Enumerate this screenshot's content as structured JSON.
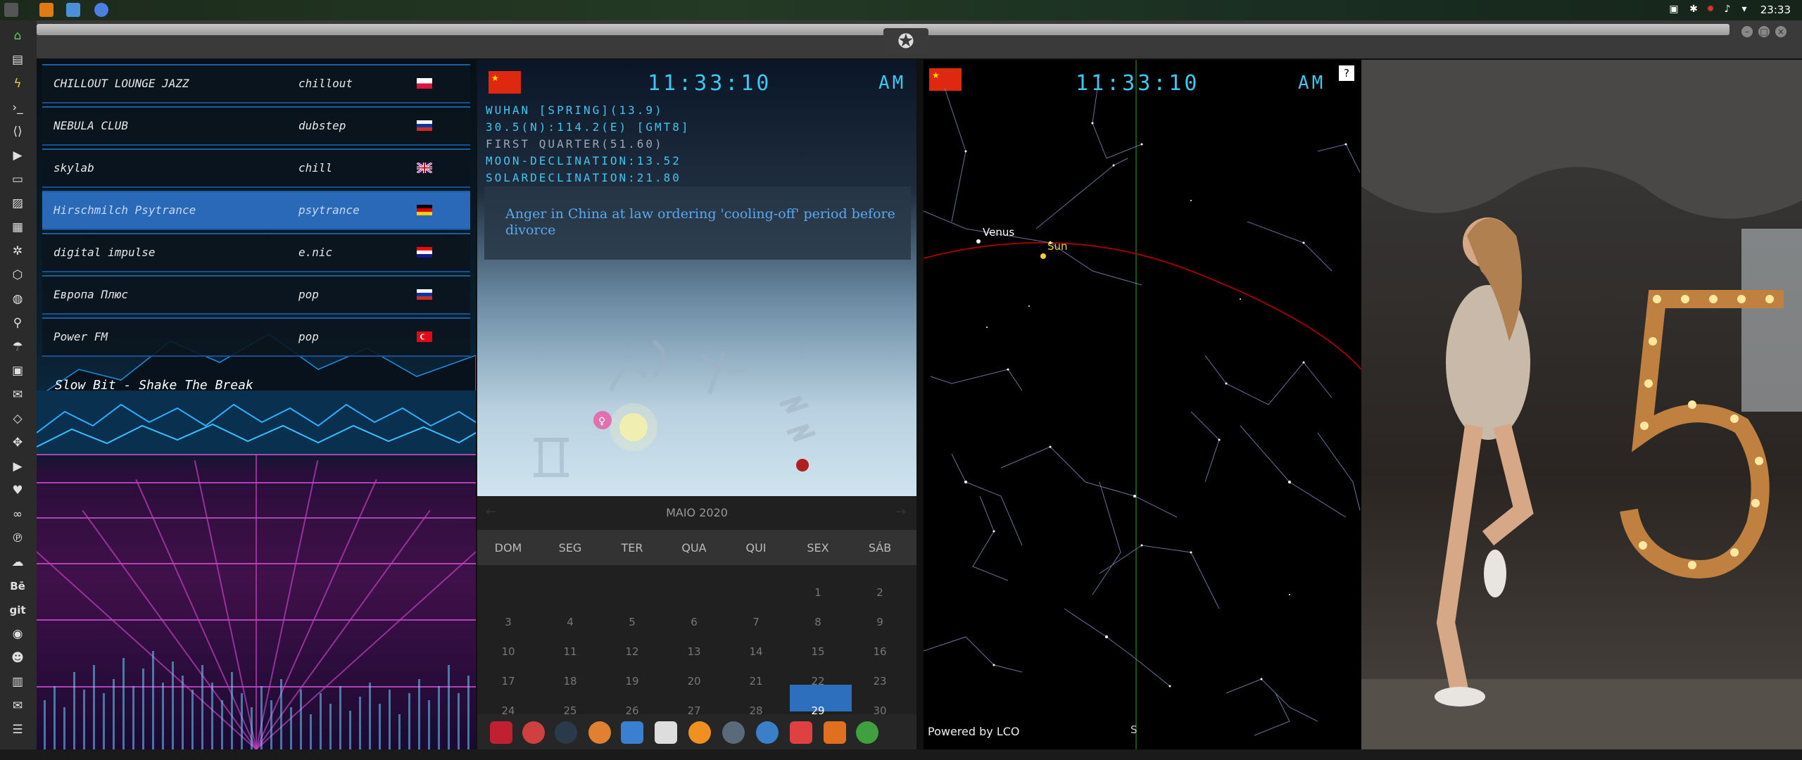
{
  "system": {
    "clock": "23:33",
    "tray_icons": [
      "photo-icon",
      "bluetooth-icon",
      "gear-red-icon",
      "volume-icon",
      "wifi-icon"
    ]
  },
  "radio": {
    "stations": [
      {
        "name": "CHILLOUT LOUNGE JAZZ",
        "genre": "chillout",
        "flag": "poland"
      },
      {
        "name": "NEBULA CLUB",
        "genre": "dubstep",
        "flag": "russia"
      },
      {
        "name": "skylab",
        "genre": "chill",
        "flag": "uk"
      },
      {
        "name": "Hirschmilch Psytrance",
        "genre": "psytrance",
        "flag": "germany"
      },
      {
        "name": "digital impulse",
        "genre": "e.nic",
        "flag": "croatia"
      },
      {
        "name": "Европа Плюс",
        "genre": "pop",
        "flag": "russia"
      },
      {
        "name": "Power FM",
        "genre": "pop",
        "flag": "turkey"
      }
    ],
    "now_playing": "Slow Bit - Shake The Break"
  },
  "clock_panel": {
    "time": "11:33:10",
    "ampm": "AM",
    "lines": [
      "WUHAN [SPRING](13.9)",
      "30.5(N):114.2(E) [GMT8]",
      "FIRST QUARTER(51.60)",
      "MOON-DECLINATION:13.52",
      "SOLARDECLINATION:21.80"
    ],
    "news": "Anger in China at law ordering 'cooling-off' period before divorce"
  },
  "calendar": {
    "month": "MAIO 2020",
    "days": [
      "DOM",
      "SEG",
      "TER",
      "QUA",
      "QUI",
      "SEX",
      "SÁB"
    ],
    "weeks": [
      [
        "",
        "",
        "",
        "",
        "",
        "1",
        "2"
      ],
      [
        "3",
        "4",
        "5",
        "6",
        "7",
        "8",
        "9"
      ],
      [
        "10",
        "11",
        "12",
        "13",
        "14",
        "15",
        "16"
      ],
      [
        "17",
        "18",
        "19",
        "20",
        "21",
        "22",
        "23"
      ],
      [
        "24",
        "25",
        "26",
        "27",
        "28",
        "29",
        "30"
      ]
    ],
    "today": "29"
  },
  "sky": {
    "time": "11:33:10",
    "ampm": "AM",
    "help": "?",
    "venus_label": "Venus",
    "sun_label": "Sun",
    "powered_by": "Powered by LCO",
    "south": "S"
  }
}
